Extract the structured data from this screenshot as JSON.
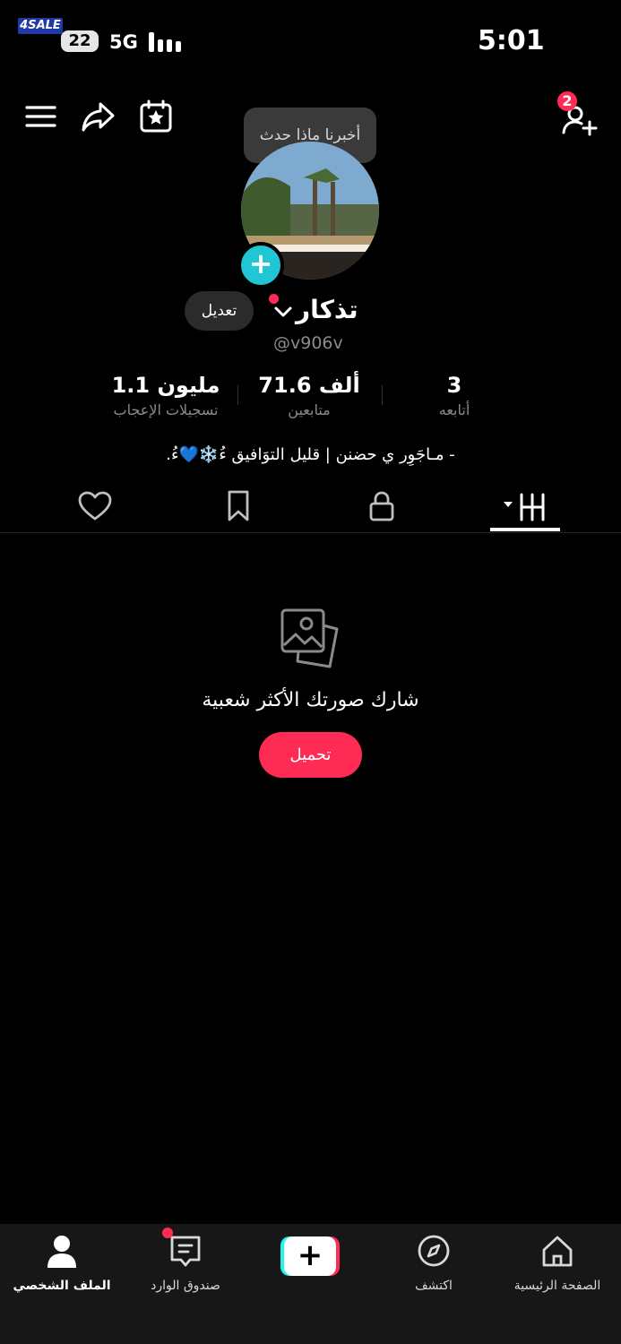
{
  "status_bar": {
    "watermark": "4SALE",
    "battery": "22",
    "network": "5G",
    "time": "5:01"
  },
  "header": {
    "tooltip": "أخبرنا ماذا حدث",
    "add_friends_badge": "2"
  },
  "profile": {
    "name": "تذكار",
    "edit_label": "تعديل",
    "handle": "@v906v",
    "bio": "- مـاجَوِر ي حضنن | قليل التوَافيق ءُ❄️💙ءُ."
  },
  "stats": {
    "likes": {
      "value": "1.1 مليون",
      "label": "تسجيلات الإعجاب"
    },
    "followers": {
      "value": "71.6 ألف",
      "label": "متابعين"
    },
    "following": {
      "value": "3",
      "label": "أتابعه"
    }
  },
  "tabs": [
    "liked",
    "favorites",
    "private",
    "videos"
  ],
  "active_tab": "videos",
  "empty_state": {
    "title": "شارك صورتك الأكثر شعبية",
    "button": "تحميل"
  },
  "bottom_nav": {
    "profile": "الملف الشخصي",
    "inbox": "صندوق الوارد",
    "create": "+",
    "discover": "اكتشف",
    "home": "الصفحة الرئيسية"
  },
  "colors": {
    "accent": "#fe2c55",
    "cyan": "#25f4ee",
    "background": "#000000"
  }
}
